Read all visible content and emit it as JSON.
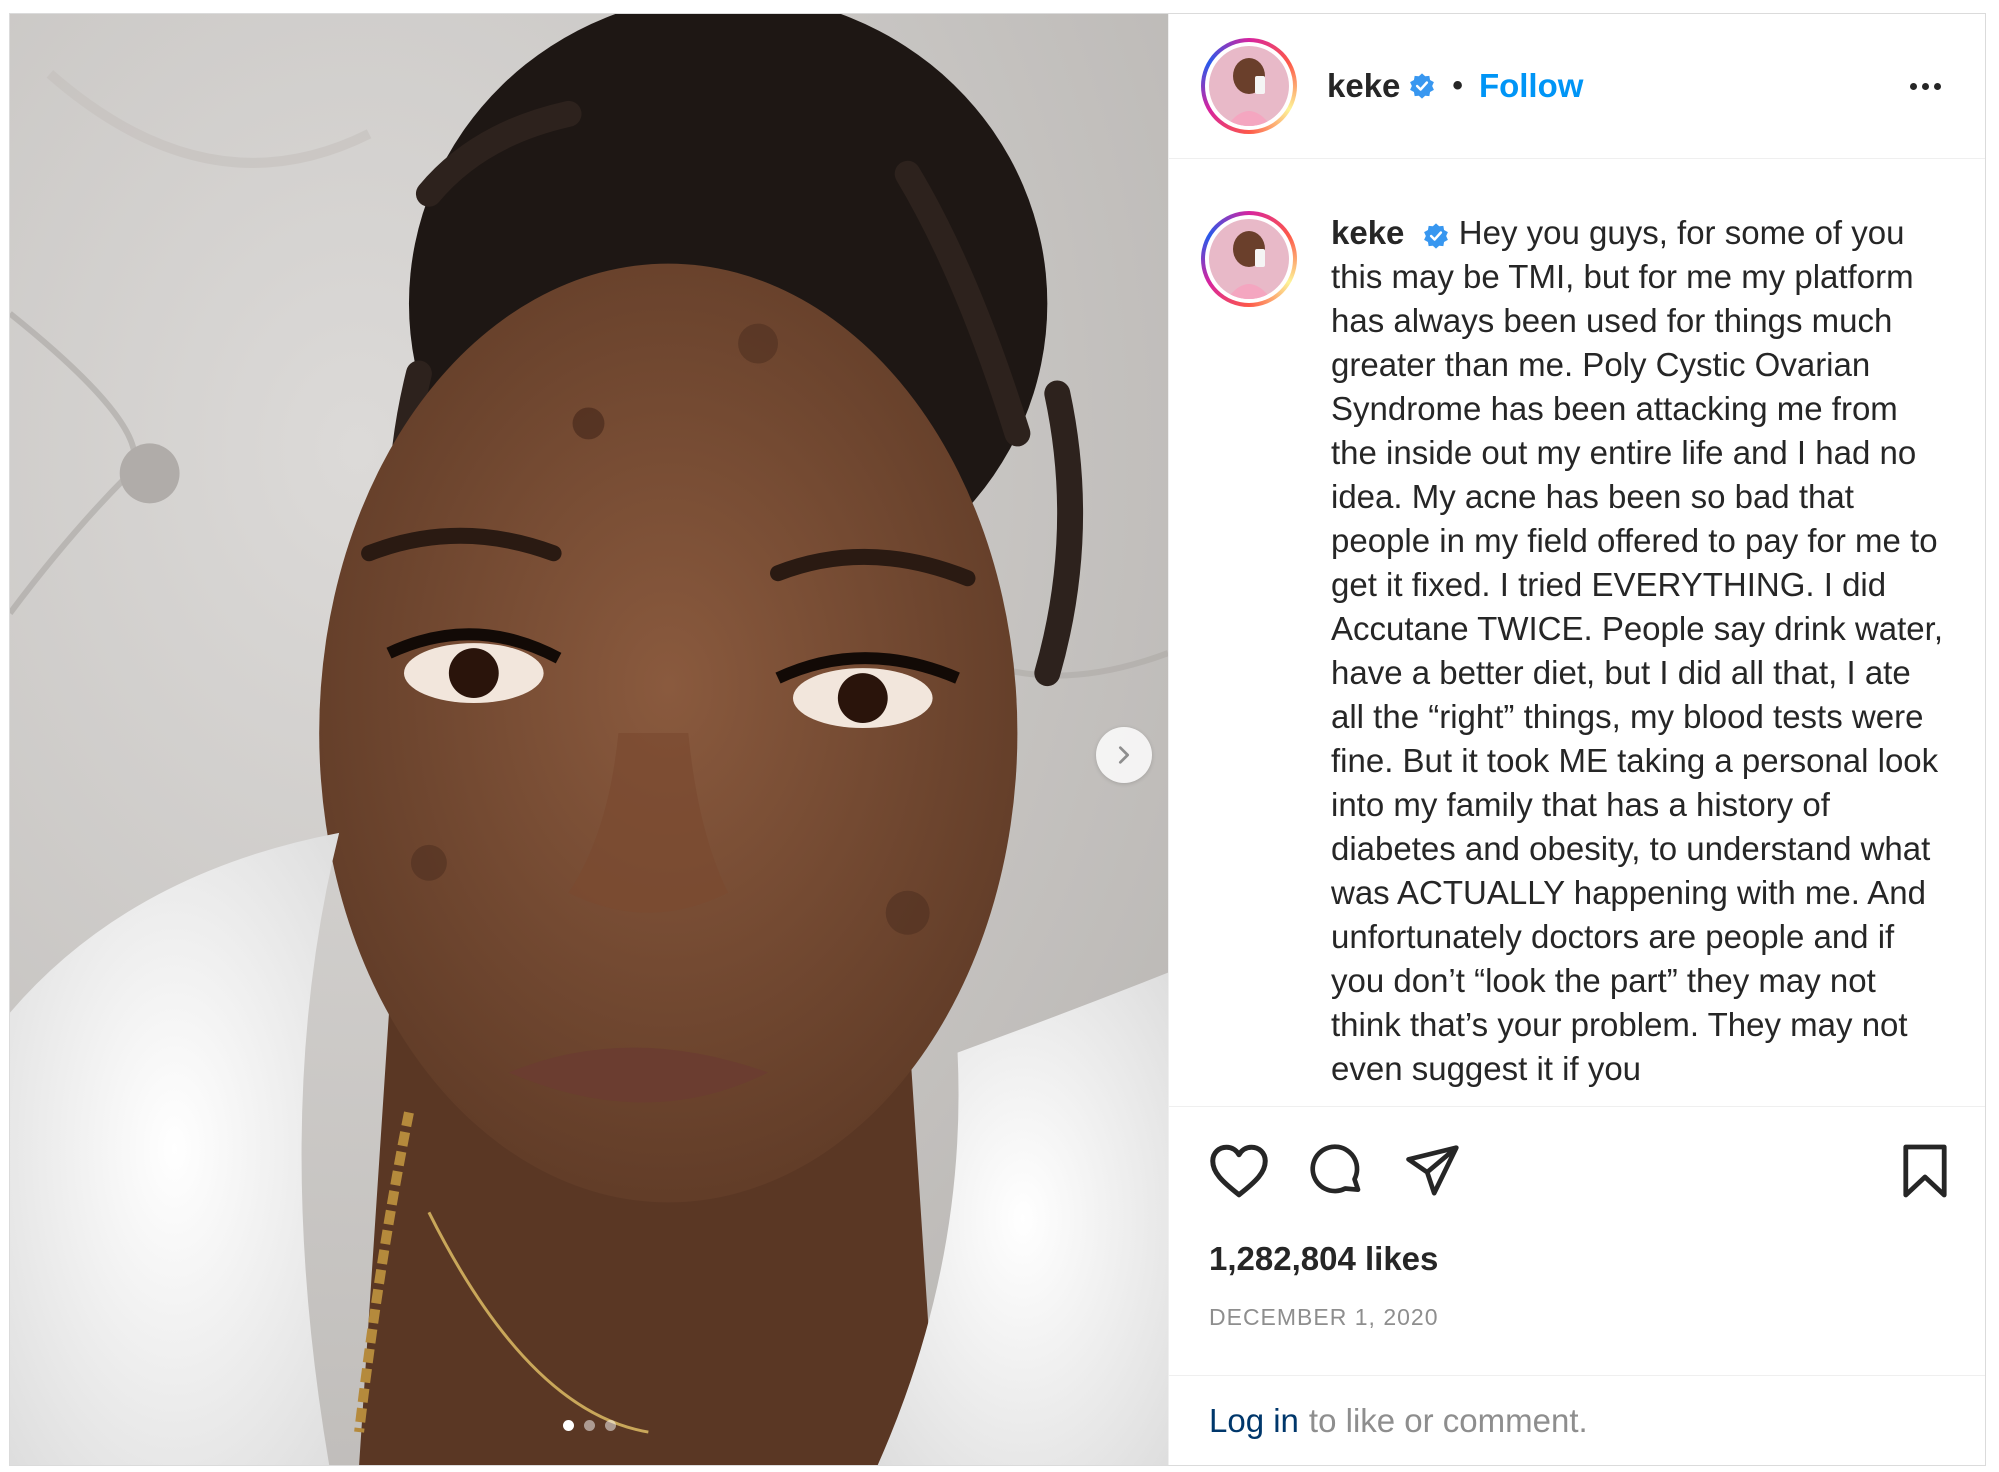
{
  "post": {
    "username": "keke",
    "follow_label": "Follow",
    "separator": "•",
    "caption_text": "Hey you guys, for some of you this may be TMI, but for me my platform has always been used for things much greater than me. Poly Cystic Ovarian Syndrome has been attacking me from the inside out my entire life and I had no idea. My acne has been so bad that people in my field offered to pay for me to get it fixed. I tried EVERYTHING. I did Accutane TWICE. People say drink water, have a better diet, but I did all that, I ate all the “right” things, my blood tests were fine. But it took ME taking a personal look into my family that has a history of diabetes and obesity, to understand what was ACTUALLY happening with me. And unfortunately doctors are people and if you don’t “look the part” they may not think that’s your problem. They may not even suggest it if you",
    "likes": "1,282,804 likes",
    "date": "DECEMBER 1, 2020",
    "login_link": "Log in",
    "login_rest": "to like or comment.",
    "carousel": {
      "slide_count": 3,
      "active_index": 0
    }
  },
  "colors": {
    "link_blue": "#0095f6",
    "login_blue": "#00376b",
    "muted": "#8e8e8e",
    "text": "#262626",
    "verified": "#3897f0"
  },
  "icons": [
    "heart-icon",
    "comment-icon",
    "share-icon",
    "bookmark-icon",
    "verified-badge-icon",
    "more-options-icon",
    "chevron-right-icon"
  ]
}
